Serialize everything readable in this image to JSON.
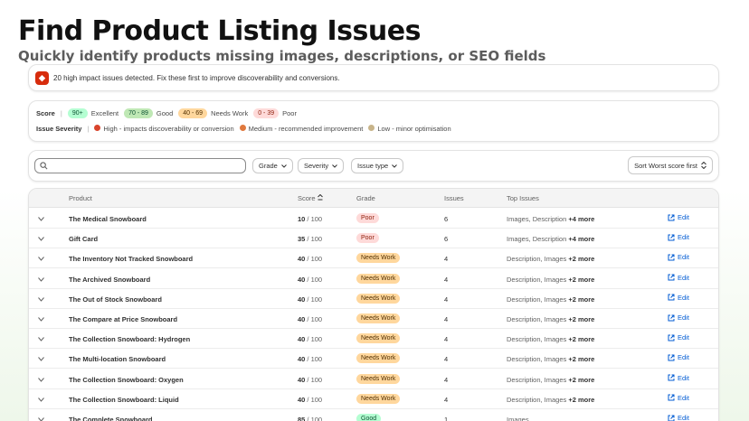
{
  "header": {
    "title": "Find Product Listing Issues",
    "subtitle": "Quickly identify products missing images, descriptions, or SEO fields"
  },
  "banner": {
    "icon": "alert-diamond-icon",
    "text": "20 high impact issues detected. Fix these first to improve discoverability and conversions."
  },
  "legend": {
    "score_label": "Score",
    "grades": [
      {
        "range": "90+",
        "label": "Excellent"
      },
      {
        "range": "70 - 89",
        "label": "Good"
      },
      {
        "range": "40 - 69",
        "label": "Needs Work"
      },
      {
        "range": "0 - 39",
        "label": "Poor"
      }
    ],
    "severity_label": "Issue Severity",
    "severities": [
      {
        "label": "High - impacts discoverability or conversion",
        "color": "#d9442c"
      },
      {
        "label": "Medium - recommended improvement",
        "color": "#e0793e"
      },
      {
        "label": "Low - minor optimisation",
        "color": "#c8b48a"
      }
    ]
  },
  "filters": {
    "search_placeholder": "",
    "grade": "Grade",
    "severity": "Severity",
    "issue_type": "Issue type",
    "sort": "Sort Worst score first"
  },
  "table": {
    "columns": {
      "product": "Product",
      "score": "Score",
      "grade": "Grade",
      "issues": "Issues",
      "top_issues": "Top Issues"
    },
    "edit_label": "Edit",
    "score_suffix": " / 100",
    "rows": [
      {
        "name": "The Medical Snowboard",
        "score": "10",
        "grade": "Poor",
        "grade_class": "poor",
        "issues": "6",
        "top": "Images, Description",
        "more": "+4 more"
      },
      {
        "name": "Gift Card",
        "score": "35",
        "grade": "Poor",
        "grade_class": "poor",
        "issues": "6",
        "top": "Images, Description",
        "more": "+4 more"
      },
      {
        "name": "The Inventory Not Tracked Snowboard",
        "score": "40",
        "grade": "Needs Work",
        "grade_class": "needs",
        "issues": "4",
        "top": "Description, Images",
        "more": "+2 more"
      },
      {
        "name": "The Archived Snowboard",
        "score": "40",
        "grade": "Needs Work",
        "grade_class": "needs",
        "issues": "4",
        "top": "Description, Images",
        "more": "+2 more"
      },
      {
        "name": "The Out of Stock Snowboard",
        "score": "40",
        "grade": "Needs Work",
        "grade_class": "needs",
        "issues": "4",
        "top": "Description, Images",
        "more": "+2 more"
      },
      {
        "name": "The Compare at Price Snowboard",
        "score": "40",
        "grade": "Needs Work",
        "grade_class": "needs",
        "issues": "4",
        "top": "Description, Images",
        "more": "+2 more"
      },
      {
        "name": "The Collection Snowboard: Hydrogen",
        "score": "40",
        "grade": "Needs Work",
        "grade_class": "needs",
        "issues": "4",
        "top": "Description, Images",
        "more": "+2 more"
      },
      {
        "name": "The Multi-location Snowboard",
        "score": "40",
        "grade": "Needs Work",
        "grade_class": "needs",
        "issues": "4",
        "top": "Description, Images",
        "more": "+2 more"
      },
      {
        "name": "The Collection Snowboard: Oxygen",
        "score": "40",
        "grade": "Needs Work",
        "grade_class": "needs",
        "issues": "4",
        "top": "Description, Images",
        "more": "+2 more"
      },
      {
        "name": "The Collection Snowboard: Liquid",
        "score": "40",
        "grade": "Needs Work",
        "grade_class": "needs",
        "issues": "4",
        "top": "Description, Images",
        "more": "+2 more"
      },
      {
        "name": "The Complete Snowboard",
        "score": "85",
        "grade": "Good",
        "grade_class": "good",
        "issues": "1",
        "top": "Images",
        "more": ""
      }
    ]
  }
}
